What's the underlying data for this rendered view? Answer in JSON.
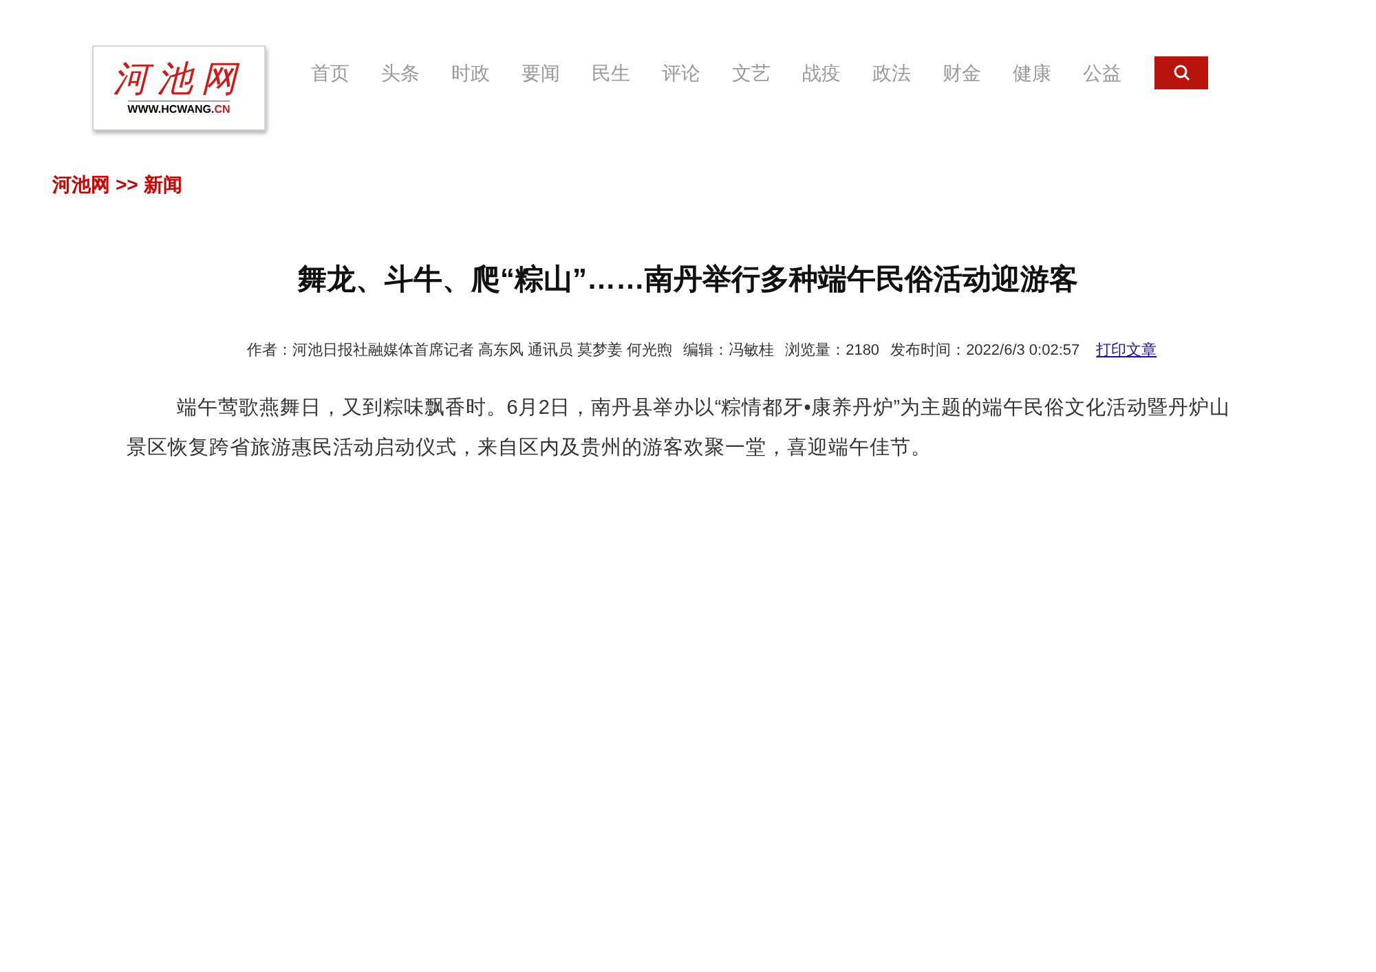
{
  "logo": {
    "calligraphy": "河池网",
    "url": "WWW.HCWANG.",
    "tld": "CN"
  },
  "nav": [
    {
      "label": "首页"
    },
    {
      "label": "头条"
    },
    {
      "label": "时政"
    },
    {
      "label": "要闻"
    },
    {
      "label": "民生"
    },
    {
      "label": "评论"
    },
    {
      "label": "文艺"
    },
    {
      "label": "战疫"
    },
    {
      "label": "政法"
    },
    {
      "label": "财金"
    },
    {
      "label": "健康"
    },
    {
      "label": "公益"
    }
  ],
  "breadcrumb": [
    "河池网",
    ">>",
    "新闻"
  ],
  "article": {
    "title": "舞龙、斗牛、爬“粽山”……南丹举行多种端午民俗活动迎游客",
    "meta": [
      "作者：河池日报社融媒体首席记者 高东风 通讯员 莫梦姜 何光煦",
      "编辑：冯敏桂",
      "浏览量：2180",
      "发布时间：2022/6/3 0:02:57"
    ],
    "print_link": "打印文章",
    "paragraphs": [
      "端午莺歌燕舞日，又到粽味飘香时。6月2日，南丹县举办以“粽情都牙•康养丹炉”为主题的端午民俗文化活动暨丹炉山景区恢复跨省旅游惠民活动启动仪式，来自区内及贵州的游客欢聚一堂，喜迎端午佳节。"
    ]
  }
}
